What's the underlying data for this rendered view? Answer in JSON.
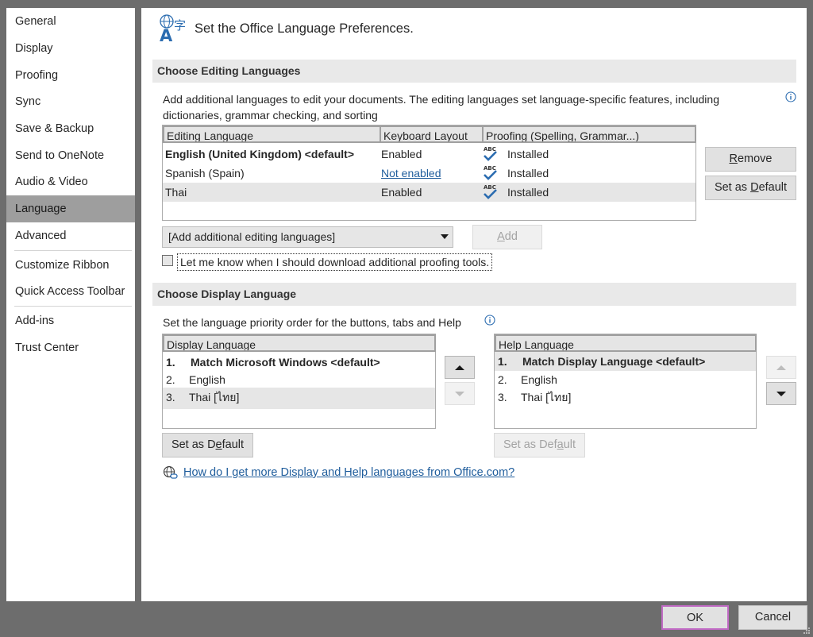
{
  "sidebar": {
    "items": [
      {
        "label": "General",
        "active": false
      },
      {
        "label": "Display",
        "active": false
      },
      {
        "label": "Proofing",
        "active": false
      },
      {
        "label": "Sync",
        "active": false
      },
      {
        "label": "Save & Backup",
        "active": false
      },
      {
        "label": "Send to OneNote",
        "active": false
      },
      {
        "label": "Audio & Video",
        "active": false
      },
      {
        "label": "Language",
        "active": true
      },
      {
        "label": "Advanced",
        "active": false
      },
      {
        "label": "Customize Ribbon",
        "active": false
      },
      {
        "label": "Quick Access Toolbar",
        "active": false
      },
      {
        "label": "Add-ins",
        "active": false
      },
      {
        "label": "Trust Center",
        "active": false
      }
    ]
  },
  "header": {
    "title": "Set the Office Language Preferences.",
    "icon": "language-icon"
  },
  "editing": {
    "section_title": "Choose Editing Languages",
    "description_line1": "Add additional languages to edit your documents. The editing languages set language-specific features, including",
    "description_line2": "dictionaries, grammar checking, and sorting",
    "columns": [
      "Editing Language",
      "Keyboard Layout",
      "Proofing (Spelling, Grammar...)"
    ],
    "rows": [
      {
        "language": "English (United Kingdom) <default>",
        "keyboard": "Enabled",
        "proofing": "Installed"
      },
      {
        "language": "Spanish (Spain)",
        "keyboard": "Not enabled",
        "proofing": "Installed"
      },
      {
        "language": "Thai",
        "keyboard": "Enabled",
        "proofing": "Installed"
      }
    ],
    "remove_pre": "",
    "remove_acc": "R",
    "remove_post": "emove",
    "set_default_pre": "Set as ",
    "set_default_acc": "D",
    "set_default_post": "efault",
    "add_dropdown_value": "[Add additional editing languages]",
    "add_pre": "",
    "add_acc": "A",
    "add_post": "dd",
    "notify_checkbox_label": "Let me know when I should download additional proofing tools.",
    "notify_checked": false,
    "abc_text": "ABC"
  },
  "display": {
    "section_title": "Choose Display Language",
    "description": "Set the language priority order for the buttons, tabs and Help",
    "display_header": "Display Language",
    "display_items": [
      {
        "num": "1.",
        "label": "Match Microsoft Windows <default>"
      },
      {
        "num": "2.",
        "label": "English"
      },
      {
        "num": "3.",
        "label": "Thai [ไทย]"
      }
    ],
    "help_header": "Help Language",
    "help_items": [
      {
        "num": "1.",
        "label": "Match Display Language <default>"
      },
      {
        "num": "2.",
        "label": "English"
      },
      {
        "num": "3.",
        "label": "Thai [ไทย]"
      }
    ],
    "set_default_pre": "Set as D",
    "set_default_acc": "e",
    "set_default_post": "fault",
    "help_set_default_pre": "Set as Def",
    "help_set_default_acc": "a",
    "help_set_default_post": "ult",
    "link_text": "How do I get more Display and Help languages from Office.com?"
  },
  "footer": {
    "ok_label": "OK",
    "cancel_label": "Cancel"
  },
  "colors": {
    "accent_link": "#1f5d9c",
    "ok_border": "#c16bc5",
    "selected_nav": "#9e9e9e",
    "check_blue": "#2b6cb0"
  }
}
